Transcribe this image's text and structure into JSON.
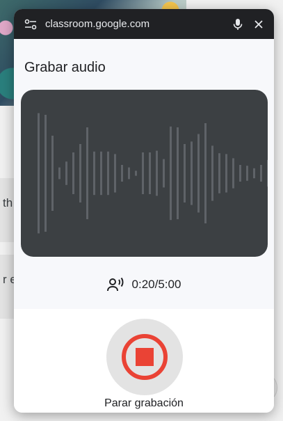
{
  "browser": {
    "url": "classroom.google.com",
    "icons": {
      "site_settings": "tune-icon",
      "mic": "mic-icon",
      "close": "close-icon"
    }
  },
  "background": {
    "card1_text": "th",
    "card2_text": "r es"
  },
  "dialog": {
    "title": "Grabar audio",
    "timer": "0:20/5:00",
    "timer_icon": "voice-icon",
    "stop_label": "Parar grabación",
    "stop_icon": "stop-record-icon",
    "colors": {
      "wave_bg": "#3c4043",
      "wave_bar": "#5f6368",
      "stop_red": "#ea4335",
      "titlebar": "#202124"
    }
  },
  "waveform": {
    "levels": [
      0.72,
      0.7,
      0.45,
      0.07,
      0.14,
      0.25,
      0.35,
      0.55,
      0.26,
      0.26,
      0.26,
      0.23,
      0.1,
      0.07,
      0.03,
      0.25,
      0.25,
      0.27,
      0.17,
      0.56,
      0.55,
      0.35,
      0.38,
      0.47,
      0.6,
      0.33,
      0.24,
      0.23,
      0.18,
      0.1,
      0.09,
      0.06,
      0.1,
      0.16
    ]
  }
}
